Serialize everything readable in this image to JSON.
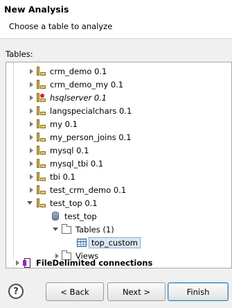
{
  "header": {
    "title": "New Analysis",
    "subtitle": "Choose a table to analyze"
  },
  "tables_label": "Tables:",
  "tree": {
    "connections": [
      {
        "label": "crm_demo 0.1",
        "italic": false
      },
      {
        "label": "crm_demo_my 0.1",
        "italic": false
      },
      {
        "label": "hsqlserver 0.1",
        "italic": true,
        "error": true
      },
      {
        "label": "langspecialchars 0.1",
        "italic": false
      },
      {
        "label": "my 0.1",
        "italic": false
      },
      {
        "label": "my_person_joins 0.1",
        "italic": false
      },
      {
        "label": "mysql 0.1",
        "italic": false
      },
      {
        "label": "mysql_tbi 0.1",
        "italic": false
      },
      {
        "label": "tbi 0.1",
        "italic": false
      },
      {
        "label": "test_crm_demo 0.1",
        "italic": false
      },
      {
        "label": "test_top 0.1",
        "italic": false
      }
    ],
    "catalog": "test_top",
    "tables_folder": "Tables (1)",
    "selected_table": "top_custom",
    "views_folder": "Views",
    "file_delimited": "FileDelimited connections"
  },
  "buttons": {
    "help": "?",
    "back": "< Back",
    "next": "Next >",
    "finish": "Finish"
  }
}
